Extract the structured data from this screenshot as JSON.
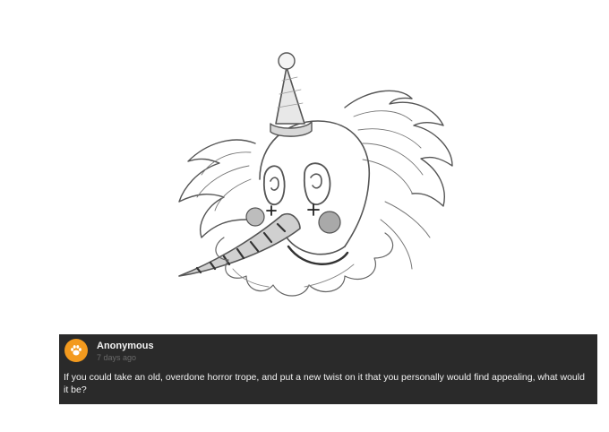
{
  "artwork": {
    "icon": "clown-sketch-illustration"
  },
  "ask": {
    "avatar_icon": "paw-icon",
    "avatar_color": "#f39a1e",
    "card_background": "#2a2a2a",
    "asker_name": "Anonymous",
    "timestamp": "7 days ago",
    "question": "If you could take an old, overdone horror trope, and put a new twist on it that you personally would find appealing, what would it be?"
  }
}
